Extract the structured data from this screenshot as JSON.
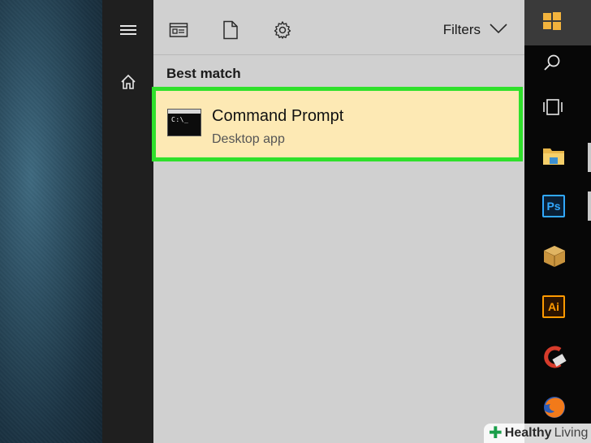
{
  "panel": {
    "filters_label": "Filters",
    "section_label": "Best match"
  },
  "result": {
    "title": "Command Prompt",
    "subtitle": "Desktop app",
    "icon_text": "C:\\_"
  },
  "taskbar": {
    "photoshop_label": "Ps",
    "illustrator_label": "Ai"
  },
  "watermark": {
    "brand_bold": "Healthy",
    "brand_light": "Living"
  },
  "colors": {
    "highlight_border": "#2fe02b",
    "result_bg": "#fde9b4",
    "panel_bg": "#d0d0d0"
  },
  "icons": [
    "hamburger-icon",
    "home-icon",
    "document-view-icon",
    "file-icon",
    "gear-icon",
    "chevron-down-icon",
    "windows-logo-icon",
    "search-icon",
    "task-view-icon",
    "file-explorer-icon",
    "photoshop-icon",
    "package-icon",
    "illustrator-icon",
    "ccleaner-icon",
    "firefox-icon"
  ]
}
